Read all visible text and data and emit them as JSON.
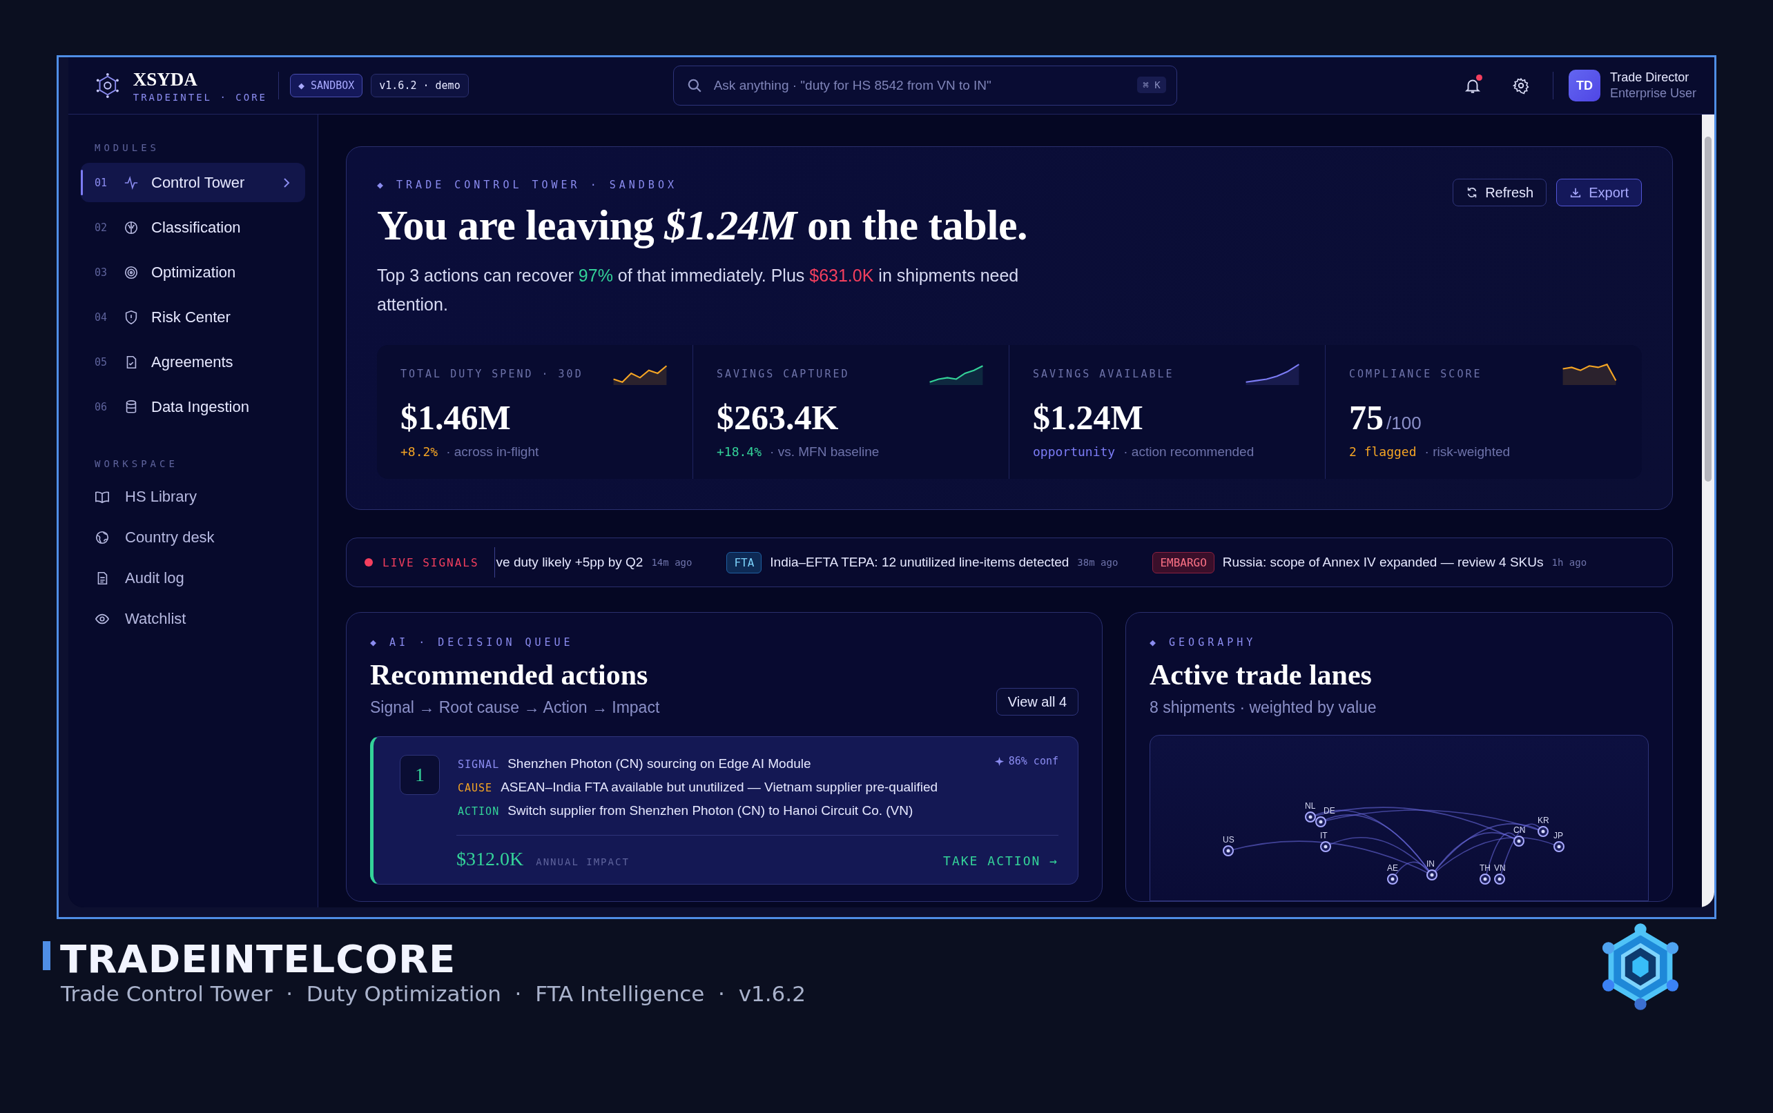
{
  "brand": {
    "name": "XSYDA",
    "tagline": "TRADEINTEL · CORE"
  },
  "env_badge": "◆ SANDBOX",
  "version_badge": "v1.6.2 · demo",
  "search": {
    "placeholder": "Ask anything · \"duty for HS 8542 from VN to IN\"",
    "shortcut": "⌘ K"
  },
  "notifications": {
    "unread": true
  },
  "user": {
    "initials": "TD",
    "name": "Trade Director",
    "role": "Enterprise User"
  },
  "sidebar": {
    "sections": [
      {
        "heading": "MODULES",
        "items": [
          {
            "index": "01",
            "label": "Control Tower",
            "selected": true
          },
          {
            "index": "02",
            "label": "Classification",
            "selected": false
          },
          {
            "index": "03",
            "label": "Optimization",
            "selected": false
          },
          {
            "index": "04",
            "label": "Risk Center",
            "selected": false
          },
          {
            "index": "05",
            "label": "Agreements",
            "selected": false
          },
          {
            "index": "06",
            "label": "Data Ingestion",
            "selected": false
          }
        ]
      },
      {
        "heading": "WORKSPACE",
        "items": [
          {
            "label": "HS Library",
            "selected": false
          },
          {
            "label": "Country desk",
            "selected": false
          },
          {
            "label": "Audit log",
            "selected": false
          },
          {
            "label": "Watchlist",
            "selected": false
          }
        ]
      }
    ]
  },
  "hero": {
    "eyebrow": "◆ TRADE CONTROL TOWER · SANDBOX",
    "headline": "You are leaving *$1.24M* on the table.",
    "summary": [
      {
        "text": "Top 3 actions can recover ",
        "kind": "plain"
      },
      {
        "text": "97%",
        "kind": "positive"
      },
      {
        "text": " of that immediately. Plus ",
        "kind": "plain"
      },
      {
        "text": "$631.0K",
        "kind": "negative"
      },
      {
        "text": " in shipments need attention.",
        "kind": "plain"
      }
    ],
    "buttons": [
      {
        "label": "Refresh",
        "kind": "refresh"
      },
      {
        "label": "Export",
        "kind": "export"
      }
    ]
  },
  "kpis": [
    {
      "label": "TOTAL DUTY SPEND · 30D",
      "value": "$1.46M",
      "delta": "+8.2%",
      "note": "· across in-flight",
      "kind": "warning"
    },
    {
      "label": "SAVINGS CAPTURED",
      "value": "$263.4K",
      "delta": "+18.4%",
      "note": "· vs. MFN baseline",
      "kind": "positive"
    },
    {
      "label": "SAVINGS AVAILABLE",
      "value": "$1.24M",
      "delta": "opportunity",
      "note": "· action recommended",
      "kind": "accent"
    },
    {
      "label": "COMPLIANCE SCORE",
      "value": "75",
      "suffix": "/100",
      "delta": "2 flagged",
      "note": "· risk-weighted",
      "kind": "warning"
    }
  ],
  "signals": {
    "label": "LIVE SIGNALS",
    "items": [
      {
        "kind": "plain",
        "text": "ve duty likely +5pp by Q2",
        "time": "14m ago"
      },
      {
        "kind": "fta",
        "tag": "FTA",
        "text": "India–EFTA TEPA: 12 unutilized line-items detected",
        "time": "38m ago"
      },
      {
        "kind": "embargo",
        "tag": "EMBARGO",
        "text": "Russia: scope of Annex IV expanded — review 4 SKUs",
        "time": "1h ago"
      }
    ]
  },
  "actions": {
    "eyebrow": "◆ AI · DECISION QUEUE",
    "title": "Recommended actions",
    "subtitle": "Signal → Root cause → Action → Impact",
    "button": "View all 4",
    "items": [
      {
        "rank": "1",
        "confidence": "86% conf",
        "lines": [
          {
            "kind": "signal",
            "label": "SIGNAL",
            "text": "Shenzhen Photon (CN) sourcing on Edge AI Module"
          },
          {
            "kind": "cause",
            "label": "CAUSE",
            "text": "ASEAN–India FTA available but unutilized — Vietnam supplier pre-qualified"
          },
          {
            "kind": "action",
            "label": "ACTION",
            "text": "Switch supplier from Shenzhen Photon (CN) to Hanoi Circuit Co. (VN)"
          }
        ],
        "impact": "$312.0K",
        "impact_label": "ANNUAL IMPACT",
        "cta": "TAKE ACTION →"
      }
    ]
  },
  "geography": {
    "eyebrow": "◆ GEOGRAPHY",
    "title": "Active trade lanes",
    "subtitle": "8 shipments · weighted by value",
    "nodes": [
      {
        "label": "US"
      },
      {
        "label": "NL"
      },
      {
        "label": "DE"
      },
      {
        "label": "IT"
      },
      {
        "label": "AE"
      },
      {
        "label": "IN"
      },
      {
        "label": "TH"
      },
      {
        "label": "VN"
      },
      {
        "label": "CN"
      },
      {
        "label": "KR"
      },
      {
        "label": "JP"
      }
    ]
  },
  "caption": {
    "title": "TRADEINTELCORE",
    "subtitle": "Trade Control Tower  ·  Duty Optimization  ·  FTA Intelligence  ·  v1.6.2"
  }
}
